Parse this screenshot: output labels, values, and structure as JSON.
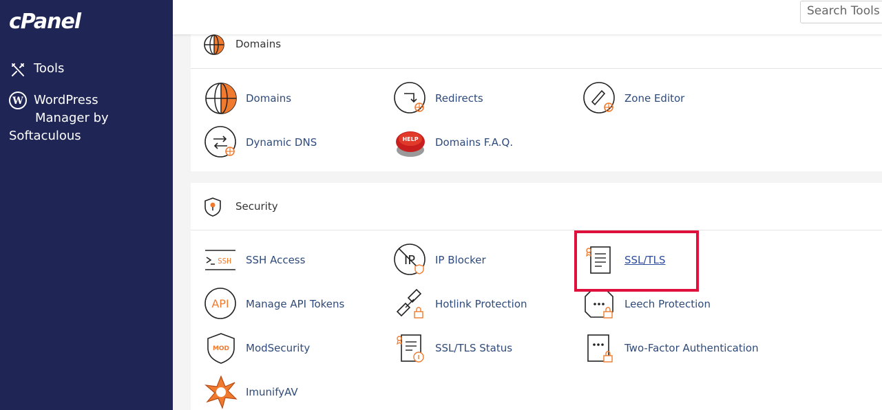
{
  "sidebar": {
    "logo": "cPanel",
    "items": [
      {
        "label": "Tools",
        "icon": "tools-icon"
      },
      {
        "label": "WordPress Manager by Softaculous",
        "line1": "WordPress",
        "line2": "Manager by",
        "line3": "Softaculous",
        "icon": "wordpress-icon"
      }
    ]
  },
  "header": {
    "search_placeholder": "Search Tools ("
  },
  "domains": {
    "title": "Domains",
    "items": [
      {
        "label": "Domains",
        "icon": "globe-icon"
      },
      {
        "label": "Redirects",
        "icon": "redirect-icon"
      },
      {
        "label": "Zone Editor",
        "icon": "zone-editor-icon"
      },
      {
        "label": "Dynamic DNS",
        "icon": "dynamic-dns-icon"
      },
      {
        "label": "Domains F.A.Q.",
        "icon": "help-button-icon"
      }
    ]
  },
  "security": {
    "title": "Security",
    "items": [
      {
        "label": "SSH Access",
        "icon": "ssh-icon"
      },
      {
        "label": "IP Blocker",
        "icon": "ip-blocker-icon"
      },
      {
        "label": "SSL/TLS",
        "icon": "ssl-certificate-icon"
      },
      {
        "label": "Manage API Tokens",
        "icon": "api-icon"
      },
      {
        "label": "Hotlink Protection",
        "icon": "hotlink-icon"
      },
      {
        "label": "Leech Protection",
        "icon": "leech-icon"
      },
      {
        "label": "ModSecurity",
        "icon": "modsecurity-icon"
      },
      {
        "label": "SSL/TLS Status",
        "icon": "ssl-status-icon"
      },
      {
        "label": "Two-Factor Authentication",
        "icon": "two-factor-icon"
      },
      {
        "label": "ImunifyAV",
        "icon": "imunify-icon"
      }
    ]
  },
  "colors": {
    "sidebar_bg": "#1f2655",
    "accent": "#f07a2e",
    "link": "#2e4a7a",
    "highlight": "#e0103c"
  }
}
